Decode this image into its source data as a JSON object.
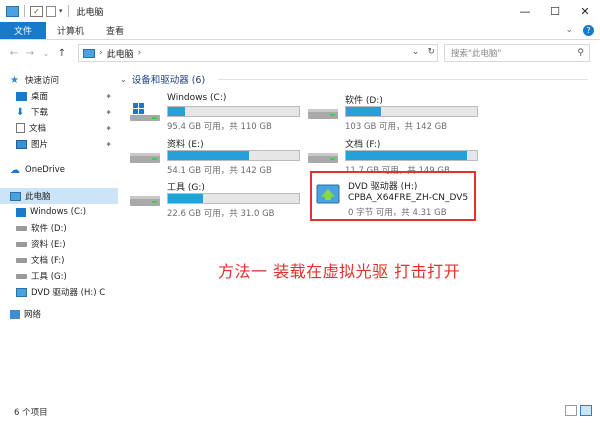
{
  "window": {
    "title": "此电脑",
    "minimize": "—",
    "maximize": "☐",
    "close": "✕"
  },
  "ribbon": {
    "tabs": [
      "文件",
      "计算机",
      "查看"
    ],
    "collapse": "⌄",
    "help": "?"
  },
  "address": {
    "back": "←",
    "forward": "→",
    "recent": "⌄",
    "up": "↑",
    "crumbs": [
      "此电脑",
      "›"
    ],
    "dropdown": "⌄",
    "refresh": "↻",
    "search_placeholder": "搜索\"此电脑\"",
    "search_icon": "⚲"
  },
  "nav": {
    "pin_glyph": "📌",
    "items": [
      {
        "label": "快速访问",
        "icon": "star-icon"
      },
      {
        "label": "桌面",
        "icon": "desktop-icon"
      },
      {
        "label": "下载",
        "icon": "download-icon"
      },
      {
        "label": "文档",
        "icon": "documents-icon"
      },
      {
        "label": "图片",
        "icon": "pictures-icon"
      },
      {
        "label": "OneDrive",
        "icon": "cloud-icon"
      },
      {
        "label": "此电脑",
        "icon": "pc-icon"
      },
      {
        "label": "Windows (C:)",
        "icon": "windows-drive-icon"
      },
      {
        "label": "软件 (D:)",
        "icon": "drive-icon"
      },
      {
        "label": "资料 (E:)",
        "icon": "drive-icon"
      },
      {
        "label": "文档 (F:)",
        "icon": "drive-icon"
      },
      {
        "label": "工具 (G:)",
        "icon": "drive-icon"
      },
      {
        "label": "DVD 驱动器 (H:) C",
        "icon": "dvd-icon"
      },
      {
        "label": "网络",
        "icon": "network-icon"
      }
    ]
  },
  "content": {
    "section_title": "设备和驱动器 (6)",
    "section_chevron": "⌄",
    "drives": [
      {
        "name": "Windows (C:)",
        "space": "95.4 GB 可用，共 110 GB",
        "used": 0.13
      },
      {
        "name": "软件 (D:)",
        "space": "103 GB 可用，共 142 GB",
        "used": 0.27
      },
      {
        "name": "资料 (E:)",
        "space": "54.1 GB 可用，共 142 GB",
        "used": 0.62
      },
      {
        "name": "文档 (F:)",
        "space": "11.7 GB 可用，共 149 GB",
        "used": 0.92
      },
      {
        "name": "工具 (G:)",
        "space": "22.6 GB 可用，共 31.0 GB",
        "used": 0.27
      }
    ],
    "dvd": {
      "name": "DVD 驱动器 (H:)",
      "label": "CPBA_X64FRE_ZH-CN_DV5",
      "space": "0 字节 可用，共 4.31 GB"
    },
    "annotation": "方法一  装载在虚拟光驱  打击打开"
  },
  "status": {
    "items": "6 个项目"
  },
  "colors": {
    "accent": "#1979ca",
    "bar_fill": "#26a0da",
    "annotation": "#e2322b"
  }
}
